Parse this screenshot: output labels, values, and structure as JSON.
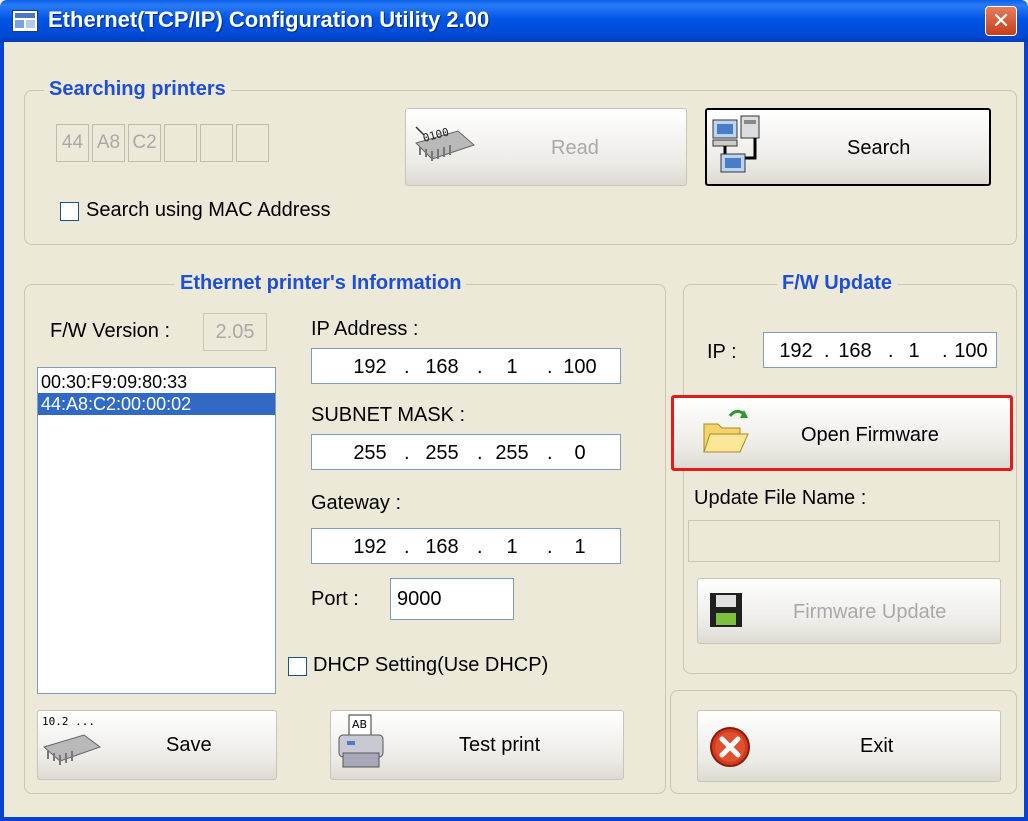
{
  "window": {
    "title": "Ethernet(TCP/IP) Configuration Utility 2.00",
    "close_glyph": "✕"
  },
  "search_group": {
    "legend": "Searching printers",
    "mac_segments": [
      "44",
      "A8",
      "C2",
      "",
      "",
      ""
    ],
    "read_label": "Read",
    "search_label": "Search",
    "mac_checkbox_label": "Search using MAC Address",
    "mac_checked": false
  },
  "info_group": {
    "legend": "Ethernet printer's Information",
    "fw_version_label": "F/W Version :",
    "fw_version_value": "2.05",
    "printers": [
      "00:30:F9:09:80:33",
      "44:A8:C2:00:00:02"
    ],
    "selected_index": 1,
    "ip_label": "IP Address :",
    "ip": [
      "192",
      "168",
      "1",
      "100"
    ],
    "subnet_label": "SUBNET MASK :",
    "subnet": [
      "255",
      "255",
      "255",
      "0"
    ],
    "gateway_label": "Gateway :",
    "gateway": [
      "192",
      "168",
      "1",
      "1"
    ],
    "port_label": "Port :",
    "port_value": "9000",
    "dhcp_label": "DHCP Setting(Use DHCP)",
    "dhcp_checked": false,
    "save_label": "Save",
    "save_icon_text": "10.2 ...",
    "test_print_label": "Test print",
    "test_print_icon_text": "AB"
  },
  "fw_group": {
    "legend": "F/W Update",
    "ip_label": "IP :",
    "ip": [
      "192",
      "168",
      "1",
      "100"
    ],
    "open_firmware_label": "Open Firmware",
    "update_file_label": "Update File Name :",
    "update_file_value": "",
    "firmware_update_label": "Firmware Update"
  },
  "exit_label": "Exit",
  "read_icon_text": "0100",
  "colors": {
    "titlebar": "#0055e5",
    "accent_legend": "#1e4fd6",
    "highlight": "#e21c1c",
    "selection": "#316ac5"
  }
}
